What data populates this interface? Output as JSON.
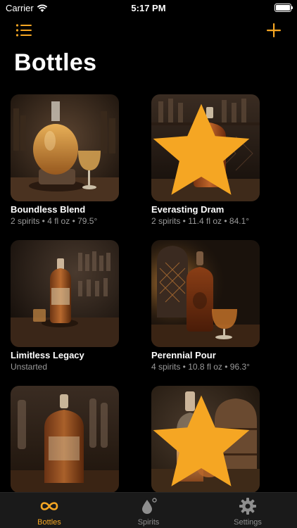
{
  "status_bar": {
    "carrier": "Carrier",
    "time": "5:17 PM",
    "battery_level": 1.0
  },
  "nav": {
    "list_icon": "list-icon",
    "add_icon": "plus-icon"
  },
  "title": "Bottles",
  "colors": {
    "accent": "#f5a623",
    "background": "#000000",
    "secondary_text": "#9a9a9a",
    "tab_bar": "#1a1a1a"
  },
  "bottles": [
    {
      "name": "Boundless Blend",
      "subtitle": "2 spirits • 4 fl oz • 79.5°",
      "favorite": false
    },
    {
      "name": "Everasting Dram",
      "subtitle": "2 spirits • 11.4 fl oz • 84.1°",
      "favorite": true
    },
    {
      "name": "Limitless Legacy",
      "subtitle": "Unstarted",
      "favorite": false
    },
    {
      "name": "Perennial Pour",
      "subtitle": "4 spirits • 10.8 fl oz • 96.3°",
      "favorite": false
    },
    {
      "name": "",
      "subtitle": "",
      "favorite": false
    },
    {
      "name": "",
      "subtitle": "",
      "favorite": true
    }
  ],
  "tabs": [
    {
      "label": "Bottles",
      "icon": "infinity-icon",
      "active": true
    },
    {
      "label": "Spirits",
      "icon": "drop-icon",
      "active": false
    },
    {
      "label": "Settings",
      "icon": "gear-icon",
      "active": false
    }
  ]
}
